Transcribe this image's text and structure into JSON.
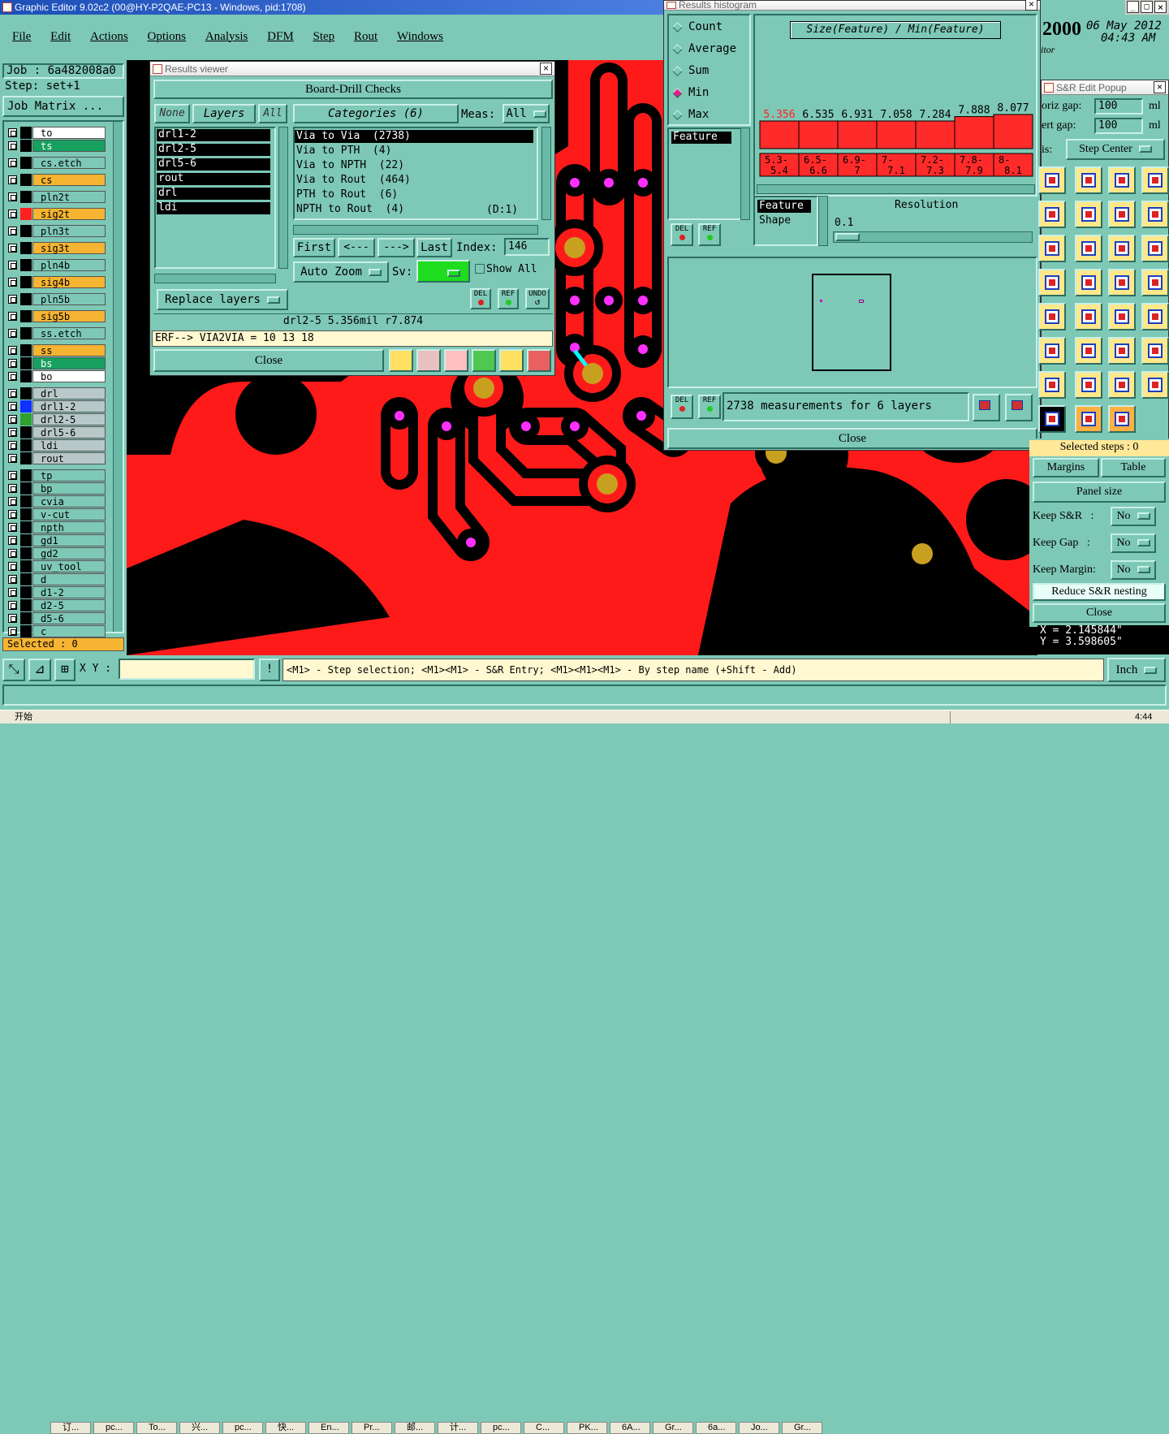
{
  "app": {
    "title": "Graphic Editor 9.02c2 (00@HY-P2QAE-PC13 - Windows, pid:1708)"
  },
  "menu": [
    "File",
    "Edit",
    "Actions",
    "Options",
    "Analysis",
    "DFM",
    "Step",
    "Rout",
    "Windows"
  ],
  "job": {
    "label": "Job : 6a482008a0",
    "step": "Step: set+1",
    "matrix_button": "Job Matrix ..."
  },
  "layers": [
    "to",
    "ts",
    "cs.etch",
    "cs",
    "pln2t",
    "sig2t",
    "pln3t",
    "sig3t",
    "pln4b",
    "sig4b",
    "pln5b",
    "sig5b",
    "ss.etch",
    "ss",
    "bs",
    "bo",
    "drl",
    "drl1-2",
    "drl2-5",
    "drl5-6",
    "ldi",
    "rout",
    "tp",
    "bp",
    "cvia",
    "v-cut",
    "npth",
    "gd1",
    "gd2",
    "uv_tool",
    "d",
    "d1-2",
    "d2-5",
    "d5-6",
    "c"
  ],
  "selected_count": "Selected : 0",
  "results_viewer": {
    "title": "Results viewer",
    "header": "Board-Drill Checks",
    "none_btn": "None",
    "layers_btn": "Layers",
    "all_btn": "All",
    "layers": [
      "drl1-2",
      "drl2-5",
      "drl5-6",
      "rout",
      "drl",
      "ldi"
    ],
    "categories_label": "Categories (6)",
    "meas_label": "Meas:",
    "meas_value": "All",
    "categories": [
      "Via to Via  (2738)",
      "Via to PTH  (4)",
      "Via to NPTH  (22)",
      "Via to Rout  (464)",
      "PTH to Rout  (6)",
      "NPTH to Rout  (4)"
    ],
    "category_extra": "(D:1)",
    "first": "First",
    "prev": "<---",
    "next": "--->",
    "last": "Last",
    "index_label": "Index:",
    "index_value": "146",
    "auto_zoom": "Auto Zoom",
    "sv_label": "Sv:",
    "show_all": "Show All",
    "del": "DEL",
    "ref": "REF",
    "undo": "UNDO",
    "replace_layers": "Replace layers",
    "status": "drl2-5 5.356mil  r7.874",
    "erf": "ERF--> VIA2VIA = 10 13 18",
    "close": "Close"
  },
  "histogram": {
    "title": "Results histogram",
    "modes": [
      "Count",
      "Average",
      "Sum",
      "Min",
      "Max"
    ],
    "selected_mode": "Min",
    "chart_title": "Size(Feature) / Min(Feature)",
    "feature_item": "Feature",
    "feature_list": [
      "Feature",
      "Shape"
    ],
    "resolution_label": "Resolution",
    "resolution_value": "0.1",
    "measurements": "2738 measurements for 6 layers",
    "del": "DEL",
    "ref": "REF",
    "close": "Close"
  },
  "chart_data": {
    "type": "bar",
    "title": "Size(Feature) / Min(Feature)",
    "categories": [
      "5.3-5.4",
      "6.5-6.6",
      "6.9-7",
      "7-7.1",
      "7.2-7.3",
      "7.8-7.9",
      "8-8.1"
    ],
    "values": [
      5.356,
      6.535,
      6.931,
      7.058,
      7.284,
      7.888,
      8.077
    ],
    "value_labels": [
      "5.356",
      "6.535",
      "6.931",
      "7.058",
      "7.284",
      "7.888",
      "8.077"
    ],
    "bin_labels_top": [
      "5.3-",
      "6.5-",
      "6.9-",
      "7-",
      "7.2-",
      "7.8-",
      "8-"
    ],
    "bin_labels_bottom": [
      "5.4",
      "6.6",
      "7",
      "7.1",
      "7.3",
      "7.9",
      "8.1"
    ],
    "colors": {
      "bar": "#ff2a2a",
      "highlight_label": "#ff2020"
    }
  },
  "right_panel": {
    "year": "2000",
    "date": "06 May 2012",
    "time": "04:43 AM",
    "editor": "itor",
    "popup_title": "S&R Edit Popup",
    "horiz_gap_label": "oriz gap:",
    "horiz_gap_value": "100",
    "horiz_unit": "ml",
    "vert_gap_label": "ert  gap:",
    "vert_gap_value": "100",
    "vert_unit": "ml",
    "dis_label": "is:",
    "step_center": "Step Center",
    "selected_steps": "Selected steps : 0",
    "margins": "Margins",
    "table": "Table",
    "panel_size": "Panel size",
    "keep_sr": "Keep S&R   :",
    "keep_gap": "Keep Gap   :",
    "keep_margin": "Keep Margin:",
    "no": "No",
    "reduce": "Reduce S&R nesting",
    "close": "Close",
    "x_coord": "X = 2.145844\"",
    "y_coord": "Y = 3.598605\""
  },
  "bottom": {
    "xy_label": "X Y :",
    "hint": "<M1> - Step selection; <M1><M1> - S&R Entry; <M1><M1><M1> - By step name (+Shift - Add)",
    "units": "Inch"
  },
  "taskbar": {
    "start": "开始",
    "items": [
      "订...",
      "pc...",
      "To...",
      "兴...",
      "pc...",
      "快...",
      "En...",
      "Pr...",
      "邮...",
      "计...",
      "pc...",
      "C...",
      "PK...",
      "6A...",
      "Gr...",
      "6a...",
      "Jo...",
      "Gr..."
    ],
    "clock": "4:44"
  },
  "colors": {
    "ui_bg": "#7ec8b6",
    "copper": "#ff1a1a",
    "pad": "#c8a020",
    "via": "#ff30ff",
    "cursor": "#00ffff"
  }
}
